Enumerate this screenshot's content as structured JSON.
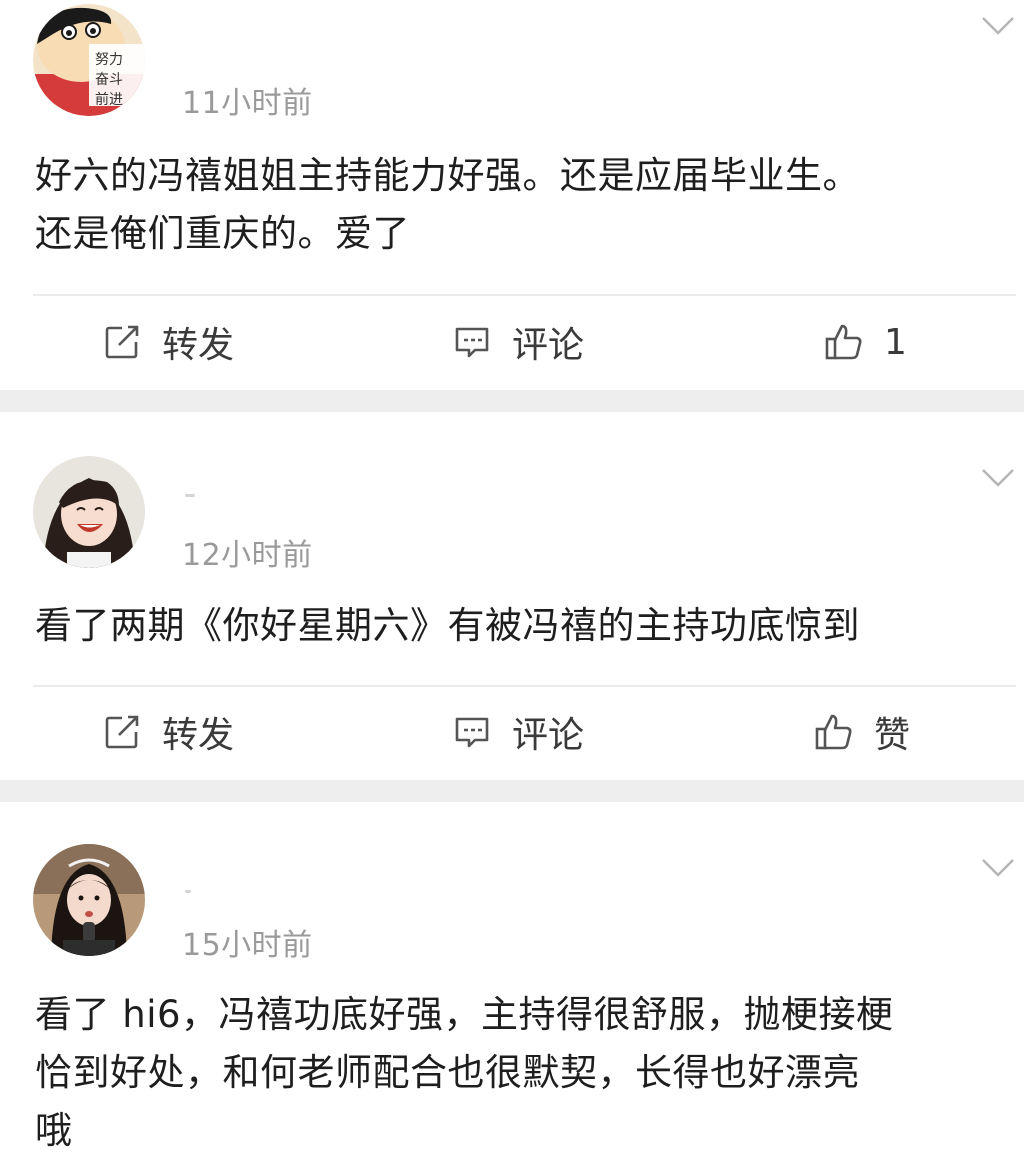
{
  "labels": {
    "repost": "转发",
    "comment": "评论",
    "like": "赞"
  },
  "posts": [
    {
      "time": "11小时前",
      "avatar_text": [
        "努力",
        "奋斗",
        "前进"
      ],
      "lines": [
        "好六的冯禧姐姐主持能力好强。还是应届毕业生。",
        "还是俺们重庆的。爱了"
      ],
      "like_value": "1"
    },
    {
      "time": "12小时前",
      "lines": [
        "看了两期《你好星期六》有被冯禧的主持功底惊到"
      ],
      "like_value": "赞"
    },
    {
      "time": "15小时前",
      "lines": [
        "看了 hi6，冯禧功底好强，主持得很舒服，抛梗接梗",
        "恰到好处，和何老师配合也很默契，长得也好漂亮",
        "哦"
      ]
    }
  ],
  "icons": {
    "repost": "repost-icon",
    "comment": "comment-icon",
    "like": "thumbs-up-icon",
    "more": "chevron-down-icon"
  },
  "colors": {
    "text": "#1e1e1e",
    "meta": "#9a9a9a",
    "separator": "#eeeeee",
    "icon": "#555555"
  }
}
